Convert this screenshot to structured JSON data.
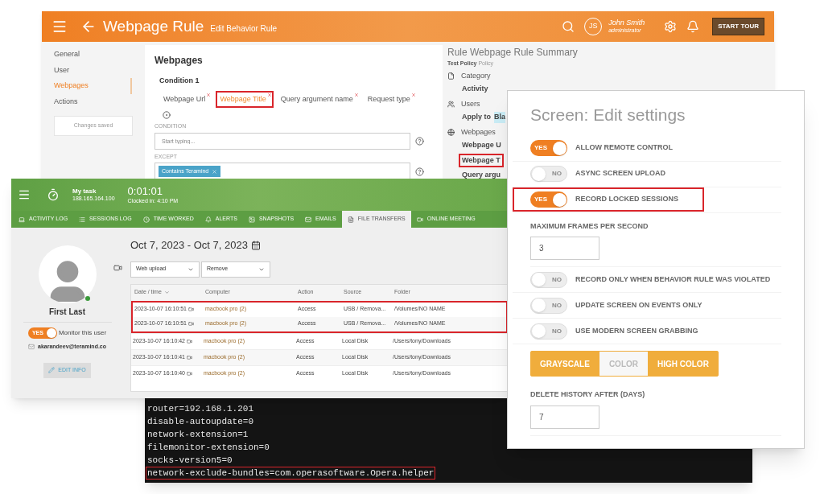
{
  "rule_window": {
    "title": "Webpage Rule",
    "subtitle": "Edit Behavior Rule",
    "user": {
      "initials": "JS",
      "name": "John Smith",
      "role": "administrator"
    },
    "start_tour": "START TOUR",
    "nav": [
      {
        "label": "General",
        "selected": false
      },
      {
        "label": "User",
        "selected": false
      },
      {
        "label": "Webpages",
        "selected": true
      },
      {
        "label": "Actions",
        "selected": false
      }
    ],
    "changes_saved": "Changes saved",
    "card": {
      "title": "Webpages",
      "condition_title": "Condition 1",
      "fields": [
        {
          "label": "Webpage Url",
          "selected": false,
          "highlighted": false
        },
        {
          "label": "Webpage Title",
          "selected": true,
          "highlighted": true
        },
        {
          "label": "Query argument name",
          "selected": false,
          "highlighted": false
        },
        {
          "label": "Request type",
          "selected": false,
          "highlighted": false
        }
      ],
      "condition_label": "CONDITION",
      "condition_placeholder": "Start typing...",
      "except_label": "EXCEPT",
      "except_tags": [
        "Contains Teramind"
      ]
    },
    "summary": {
      "title": "Rule Webpage Rule Summary",
      "policy_name": "Test Policy",
      "policy_suffix": "Policy",
      "sections": [
        {
          "kind": "document",
          "label": "Category",
          "items": [
            {
              "text": "Activity",
              "highlighted": false
            }
          ]
        },
        {
          "kind": "users",
          "label": "Users",
          "items": [
            {
              "text": "Apply to",
              "tag": "Bla",
              "highlighted": false
            }
          ]
        },
        {
          "kind": "globe",
          "label": "Webpages",
          "items": [
            {
              "text": "Webpage U",
              "highlighted": false
            },
            {
              "text": "Webpage T",
              "highlighted": true
            },
            {
              "text": "Query argu",
              "highlighted": false
            }
          ]
        }
      ]
    }
  },
  "monitor_window": {
    "task": "My task",
    "ip": "188.165.164.100",
    "timer": "0:01:01",
    "clocked": "Clocked in: 4:10 PM",
    "tabs": [
      {
        "label": "ACTIVITY LOG",
        "selected": false
      },
      {
        "label": "SESSIONS LOG",
        "selected": false
      },
      {
        "label": "TIME WORKED",
        "selected": false
      },
      {
        "label": "ALERTS",
        "selected": false
      },
      {
        "label": "SNAPSHOTS",
        "selected": false
      },
      {
        "label": "EMAILS",
        "selected": false
      },
      {
        "label": "FILE TRANSFERS",
        "selected": true
      },
      {
        "label": "ONLINE MEETING",
        "selected": false
      }
    ],
    "profile": {
      "name": "First Last",
      "online": true,
      "monitor_label": "Monitor this user",
      "monitor_on": true,
      "monitor_text": "YES",
      "email": "akarandeev@teramind.co",
      "edit": "EDIT INFO"
    },
    "date_range": "Oct 7, 2023 - Oct 7, 2023",
    "filters": [
      "Web upload",
      "Remove"
    ],
    "columns": [
      "Date / time",
      "Computer",
      "Action",
      "Source",
      "Folder"
    ],
    "rows": [
      {
        "cells": [
          "2023-10-07 16:10:51",
          "macbook pro (2)",
          "Access",
          "USB / Remova...",
          "/Volumes/NO NAME"
        ],
        "highlighted": true
      },
      {
        "cells": [
          "2023-10-07 16:10:51",
          "macbook pro (2)",
          "Access",
          "USB / Remova...",
          "/Volumes/NO NAME"
        ],
        "highlighted": true
      },
      {
        "cells": [
          "2023-10-07 16:10:42",
          "macbook pro (2)",
          "Access",
          "Local Disk",
          "/Users/tony/Downloads"
        ],
        "highlighted": false
      },
      {
        "cells": [
          "2023-10-07 16:10:41",
          "macbook pro (2)",
          "Access",
          "Local Disk",
          "/Users/tony/Downloads"
        ],
        "highlighted": false
      },
      {
        "cells": [
          "2023-10-07 16:10:40",
          "macbook pro (2)",
          "Access",
          "Local Disk",
          "/Users/tony/Downloads"
        ],
        "highlighted": false
      }
    ]
  },
  "terminal": {
    "lines": [
      {
        "text": "router=192.168.1.201",
        "highlighted": false
      },
      {
        "text": "disable-autoupdate=0",
        "highlighted": false
      },
      {
        "text": "network-extension=1",
        "highlighted": false
      },
      {
        "text": "filemonitor-extension=0",
        "highlighted": false
      },
      {
        "text": "socks-version5=0",
        "highlighted": false
      },
      {
        "text": "network-exclude-bundles=com.operasoftware.Opera.helper",
        "highlighted": true
      }
    ]
  },
  "settings_window": {
    "title": "Screen: Edit settings",
    "items": [
      {
        "kind": "toggle",
        "label": "ALLOW REMOTE CONTROL",
        "on": true,
        "text": "YES",
        "highlighted": false
      },
      {
        "kind": "toggle",
        "label": "ASYNC SCREEN UPLOAD",
        "on": false,
        "text": "NO",
        "highlighted": false
      },
      {
        "kind": "toggle",
        "label": "RECORD LOCKED SESSIONS",
        "on": true,
        "text": "YES",
        "highlighted": true
      },
      {
        "kind": "number",
        "label": "MAXIMUM FRAMES PER SECOND",
        "value": "3"
      },
      {
        "kind": "toggle",
        "label": "RECORD ONLY WHEN BEHAVIOR RULE WAS VIOLATED",
        "on": false,
        "text": "NO",
        "highlighted": false
      },
      {
        "kind": "toggle",
        "label": "UPDATE SCREEN ON EVENTS ONLY",
        "on": false,
        "text": "NO",
        "highlighted": false
      },
      {
        "kind": "toggle",
        "label": "USE MODERN SCREEN GRABBING",
        "on": false,
        "text": "NO",
        "highlighted": false
      },
      {
        "kind": "segmented",
        "options": [
          {
            "label": "GRAYSCALE",
            "selected": false
          },
          {
            "label": "COLOR",
            "selected": true
          },
          {
            "label": "HIGH COLOR",
            "selected": false
          }
        ]
      },
      {
        "kind": "number",
        "label": "DELETE HISTORY AFTER (DAYS)",
        "value": "7"
      }
    ]
  }
}
